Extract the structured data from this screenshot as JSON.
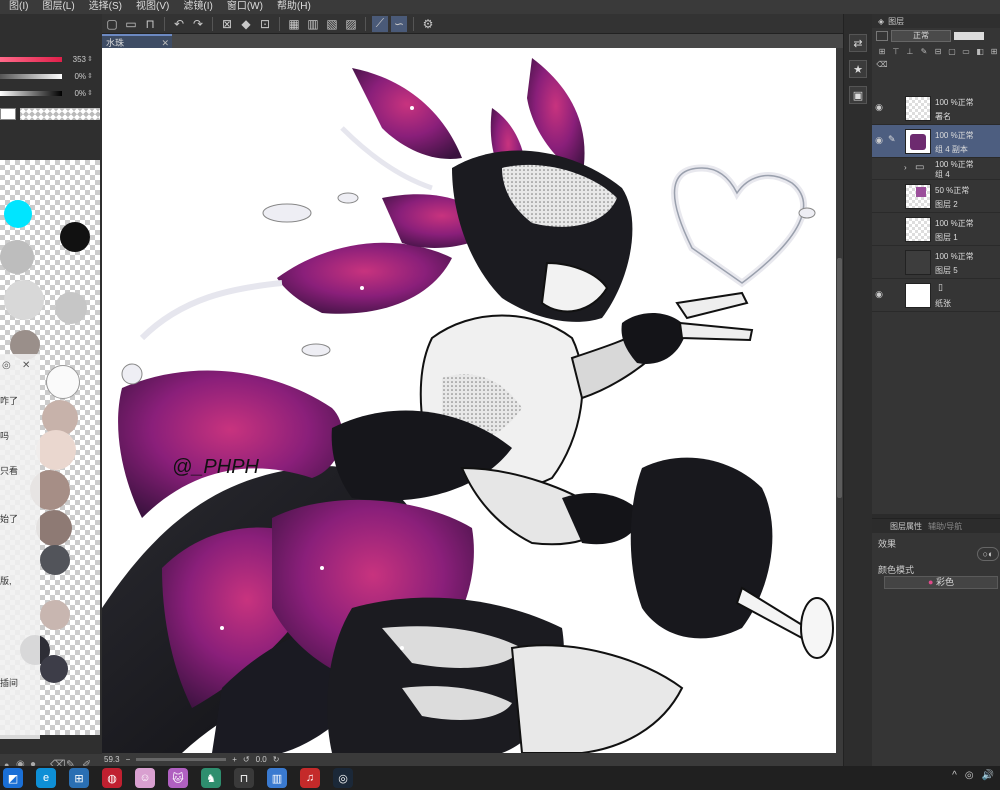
{
  "menu": {
    "items": [
      "图(I)",
      "图层(L)",
      "选择(S)",
      "视图(V)",
      "滤镜(I)",
      "窗口(W)",
      "帮助(H)"
    ]
  },
  "toolbar": {
    "icons": [
      "new-file-icon",
      "open-folder-icon",
      "save-icon",
      "undo-icon",
      "redo-icon",
      "clear-icon",
      "fill-icon",
      "transform-icon",
      "grid-icon",
      "ruler-icon",
      "stabilizer-icon",
      "curve-icon",
      "settings-icon"
    ]
  },
  "left_panel": {
    "sliders": [
      {
        "value": "353",
        "color": "#e0204a"
      },
      {
        "value": "0%",
        "color": "#d0d0d0"
      },
      {
        "value": "0%",
        "color": "#000000"
      }
    ],
    "chat_lines": [
      "咋了",
      "吗",
      "只看",
      "始了",
      "版,",
      "插间"
    ]
  },
  "document": {
    "tab_title": "水珠",
    "zoom": "59.3",
    "angle": "0.0",
    "signature": "@_PHPH"
  },
  "layers_panel": {
    "title": "图层",
    "blend_mode": "正常",
    "layers": [
      {
        "opacity": "100 %正常",
        "name": "署名",
        "visible": true,
        "active": false
      },
      {
        "opacity": "100 %正常",
        "name": "组 4 副本",
        "visible": true,
        "active": true
      },
      {
        "opacity": "100 %正常",
        "name": "组 4",
        "visible": false,
        "active": false
      },
      {
        "opacity": "50 %正常",
        "name": "图层 2",
        "visible": false,
        "active": false
      },
      {
        "opacity": "100 %正常",
        "name": "图层 1",
        "visible": false,
        "active": false
      },
      {
        "opacity": "100 %正常",
        "name": "图层 5",
        "visible": false,
        "active": false
      },
      {
        "opacity": "",
        "name": "纸张",
        "visible": true,
        "active": false
      }
    ]
  },
  "properties_panel": {
    "tab1": "图层属性",
    "tab2": "辅助/导航",
    "effect_label": "效果",
    "color_mode_label": "颜色模式",
    "color_button": "彩色"
  },
  "taskbar": {
    "icons": [
      "windows-start-icon",
      "edge-browser-icon",
      "app-icon",
      "media-icon",
      "app-icon",
      "cat-icon",
      "game-icon",
      "app-icon",
      "app-icon",
      "music-icon",
      "steam-icon"
    ],
    "tray": [
      "^",
      "◎",
      "🔊"
    ]
  }
}
